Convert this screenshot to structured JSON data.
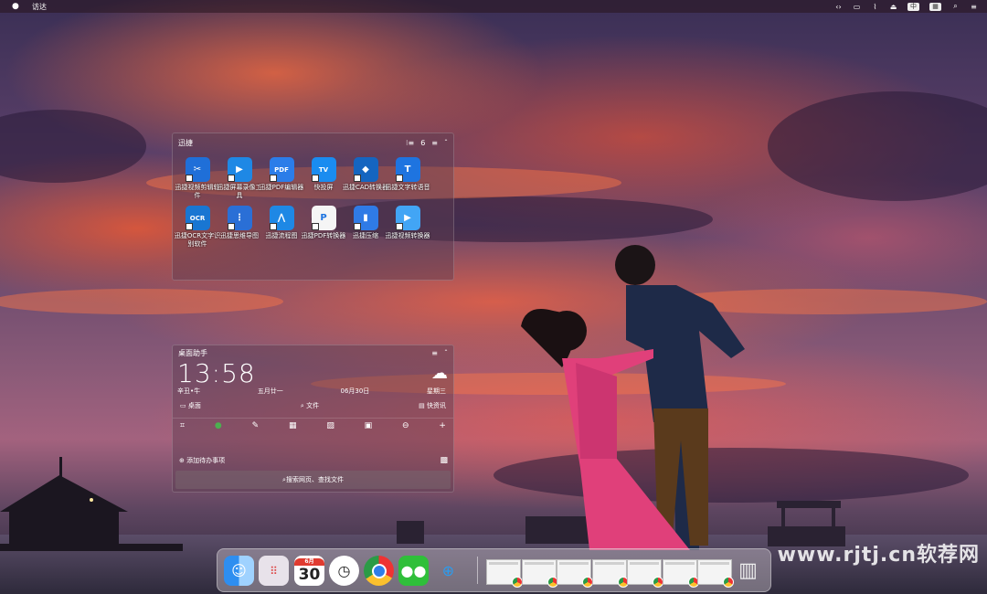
{
  "menubar": {
    "app_name": "访达",
    "right_icons": [
      "code-icon",
      "display-icon",
      "wifi-off-icon",
      "eject-icon",
      "input-method-icon",
      "keyboard-icon",
      "search-icon",
      "menu-icon"
    ],
    "input_label": "中"
  },
  "apps_panel": {
    "title": "迅捷",
    "count": "6",
    "apps": [
      {
        "label": "迅捷视频剪辑软件",
        "icon": "video-edit-icon",
        "color": "#1f6fd8",
        "glyph": "✂"
      },
      {
        "label": "迅捷屏幕录像工具",
        "icon": "screen-record-icon",
        "color": "#1e88e5",
        "glyph": "▶"
      },
      {
        "label": "迅捷PDF编辑器",
        "icon": "pdf-editor-icon",
        "color": "#2b7de9",
        "glyph": "PDF"
      },
      {
        "label": "快投屏",
        "icon": "cast-screen-icon",
        "color": "#1a8cf0",
        "glyph": "TV"
      },
      {
        "label": "迅捷CAD转换器",
        "icon": "cad-converter-icon",
        "color": "#1565c0",
        "glyph": "◆"
      },
      {
        "label": "迅捷文字转语音",
        "icon": "text-to-speech-icon",
        "color": "#1e74e0",
        "glyph": "T"
      },
      {
        "label": "迅捷OCR文字识别软件",
        "icon": "ocr-icon",
        "color": "#1976d2",
        "glyph": "OCR"
      },
      {
        "label": "迅捷思维导图",
        "icon": "mindmap-icon",
        "color": "#2a6fd6",
        "glyph": "⋮"
      },
      {
        "label": "迅捷流程图",
        "icon": "flowchart-icon",
        "color": "#1e88e5",
        "glyph": "⋀"
      },
      {
        "label": "迅捷PDF转换器",
        "icon": "pdf-converter-icon",
        "color": "#f5f5f5",
        "glyph": "P"
      },
      {
        "label": "迅捷压缩",
        "icon": "compress-icon",
        "color": "#2f7be6",
        "glyph": "▮"
      },
      {
        "label": "迅捷视频转换器",
        "icon": "video-converter-icon",
        "color": "#42a5f5",
        "glyph": "▶"
      }
    ]
  },
  "assistant_panel": {
    "title": "桌面助手",
    "time": "13:58",
    "lunar_year": "辛丑•牛",
    "lunar_date": "五月廿一",
    "date": "06月30日",
    "weekday": "星期三",
    "quick_links": [
      "桌面",
      "文件",
      "快资讯"
    ],
    "tools": [
      "crop-icon",
      "chat-icon",
      "note-icon",
      "calculator-icon",
      "image-icon",
      "lock-icon",
      "clock-icon",
      "add-icon"
    ],
    "todo_label": "添加待办事项",
    "search_placeholder": "搜索网页、查找文件"
  },
  "dock": {
    "calendar_month": "6月",
    "calendar_day": "30",
    "apps": [
      "finder-icon",
      "launchpad-icon",
      "calendar-icon",
      "clock-icon",
      "chrome-icon",
      "wechat-icon",
      "browser-icon"
    ],
    "window_thumbs": 7,
    "trash": "trash-icon"
  },
  "watermark": "www.rjtj.cn软荐网"
}
